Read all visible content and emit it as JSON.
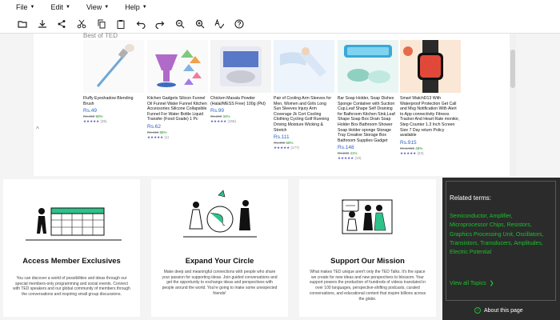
{
  "menubar": {
    "items": [
      {
        "label": "File",
        "caret": "▼"
      },
      {
        "label": "Edit",
        "caret": "▼"
      },
      {
        "label": "View",
        "caret": "▼"
      },
      {
        "label": "Help",
        "caret": "▼"
      }
    ]
  },
  "toolbar": {
    "icons": [
      "open-icon",
      "download-icon",
      "share-icon",
      "cut-icon",
      "copy-icon",
      "paste-icon",
      "undo-icon",
      "redo-icon",
      "zoom-out-icon",
      "zoom-in-icon",
      "spell-check-icon",
      "help-icon"
    ]
  },
  "products": {
    "section_title": "Best of TED",
    "items": [
      {
        "name": "Fluffy Eyeshadow Blending Brush",
        "price": "Rs.49",
        "old_price": "Rs.499",
        "discount": "90%",
        "stars": "★★★★★",
        "reviews": "(35)"
      },
      {
        "name": "Kitchen Gadgets Silicon Funnel Oil Funnel Water Funnel Kitchen Accessories Silicone Collapsible Funnel For Water Bottle Liquid Transfer (Food Grade) 1 Pc",
        "price": "Rs.62",
        "old_price": "Rs.415",
        "discount": "85%",
        "stars": "★★★★★",
        "reviews": "(1)"
      },
      {
        "name": "Chicken Masala Powder (Halal/MESS Free) 100g (Pkt)",
        "price": "Rs.99",
        "old_price": "Rs.150",
        "discount": "34%",
        "stars": "★★★★★",
        "reviews": "(156)"
      },
      {
        "name": "Pair of Cooling Arm Sleeves for Men, Women and Girls Long Sun Sleeves Injury Arm Coverage Jk Cort Cooling Clothing Cycling Golf Running Driving Moisture Wicking & Stretch",
        "price": "Rs.111",
        "old_price": "Rs.400",
        "discount": "68%",
        "stars": "★★★★★",
        "reviews": "(177)"
      },
      {
        "name": "Bar Soap Holder, Soap Dishes Sponge Container with Suction Cup,Leaf Shape Self Draining for Bathroom Kitchen Sink,Leaf Shape Soap Box Drain Soap Holder Box Bathroom Shower Soap Holder sponge Storage Tray Creative Storage Box Bathroom Supplies Gadget",
        "price": "Rs.148",
        "old_price": "Rs.249",
        "discount": "41%",
        "stars": "★★★★★",
        "reviews": "(10)"
      },
      {
        "name": "Smart WatchD13 With Waterproof Protection Get Call and Msg Notification With Alert to App connectivity Fitness Tracker And Heart Rate monitor, Step Counter 1.3 Inch Screen Size 7 Day return Policy available",
        "price": "Rs.915",
        "old_price": "Rs.1,999",
        "discount": "49%",
        "stars": "★★★★★",
        "reviews": "(22)"
      }
    ]
  },
  "cards": [
    {
      "title": "Access Member Exclusives",
      "body": "You can discover a world of possibilities and ideas through our special members-only programming and social events. Connect with TED speakers and our global community of members through the conversations and inspiring small group discussions."
    },
    {
      "title": "Expand Your Circle",
      "body": "Make deep and meaningful connections with people who share your passion for supporting ideas. Join guided conversations and get the opportunity to exchange ideas and perspectives with people around the world. You're going to make some unexpected friends!"
    },
    {
      "title": "Support Our Mission",
      "body": "What makes TED unique aren't only the TED Talks. It's the space we create for new ideas and new perspectives to blossom. Your support powers the production of hundreds of videos translated in over 100 languages, perspective-shifting podcasts, curated conversations, and educational content that inspire billions across the globe."
    }
  ],
  "related": {
    "title": "Related terms:",
    "terms": "Semiconductor, Amplifier, Microprocessor Chips, Resistors, Graphics Processing Unit, Oscillators, Transistors, Transducers, Amplitudes, Electric Potential",
    "view_all": "View all Topics",
    "view_all_arrow": "❯",
    "about": "About this page",
    "about_icon": "i"
  }
}
